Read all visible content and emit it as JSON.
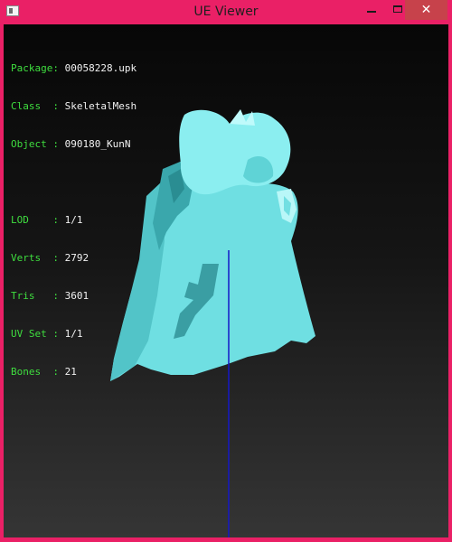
{
  "window": {
    "title": "UE Viewer",
    "close_label": "✕"
  },
  "info": {
    "package_label": "Package: ",
    "package_value": "00058228.upk",
    "class_label": "Class  : ",
    "class_value": "SkeletalMesh",
    "object_label": "Object : ",
    "object_value": "090180_KunN",
    "lod_label": "LOD    : ",
    "lod_value": "1/1",
    "verts_label": "Verts  : ",
    "verts_value": "2792",
    "tris_label": "Tris   : ",
    "tris_value": "3601",
    "uvset_label": "UV Set : ",
    "uvset_value": "1/1",
    "bones_label": "Bones  : ",
    "bones_value": "21"
  },
  "colors": {
    "frame": "#ea2066",
    "mesh": "#7fe8ea",
    "label": "#3fde3f",
    "axis": "#1010c0"
  },
  "icons": [
    "app-icon",
    "minimize-icon",
    "maximize-icon",
    "close-icon"
  ]
}
